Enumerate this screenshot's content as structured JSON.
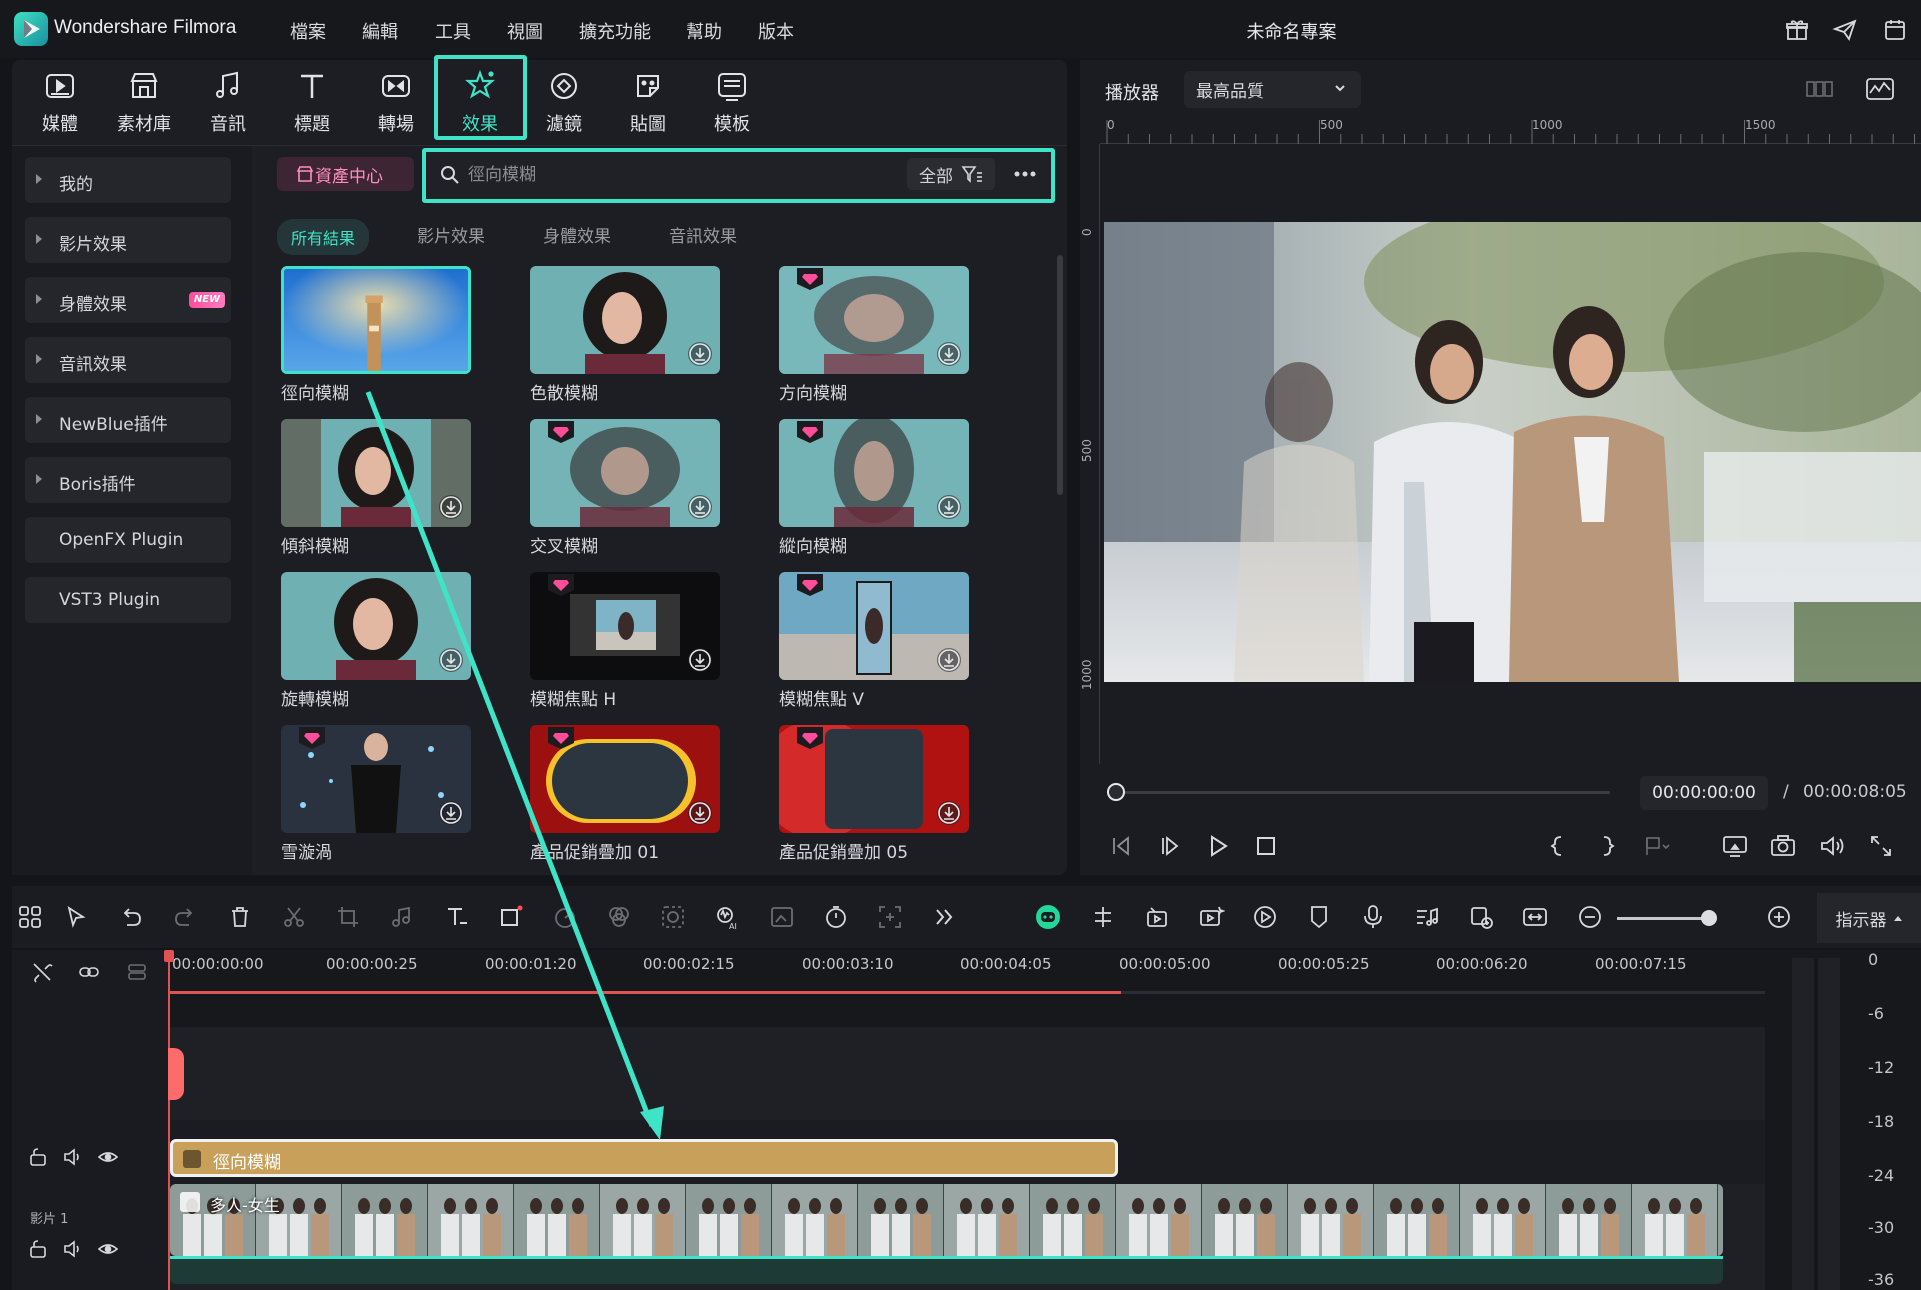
{
  "app": {
    "name": "Wondershare Filmora",
    "project_title": "未命名專案"
  },
  "menu": [
    "檔案",
    "編輯",
    "工具",
    "視圖",
    "擴充功能",
    "幫助",
    "版本"
  ],
  "library_tabs": [
    {
      "label": "媒體",
      "icon": "media-icon"
    },
    {
      "label": "素材庫",
      "icon": "stock-icon"
    },
    {
      "label": "音訊",
      "icon": "audio-icon"
    },
    {
      "label": "標題",
      "icon": "title-icon"
    },
    {
      "label": "轉場",
      "icon": "transition-icon"
    },
    {
      "label": "效果",
      "icon": "effects-icon",
      "active": true
    },
    {
      "label": "濾鏡",
      "icon": "filter-icon"
    },
    {
      "label": "貼圖",
      "icon": "sticker-icon"
    },
    {
      "label": "模板",
      "icon": "template-icon"
    }
  ],
  "sidebar": {
    "items": [
      {
        "label": "我的"
      },
      {
        "label": "影片效果"
      },
      {
        "label": "身體效果",
        "badge": "NEW"
      },
      {
        "label": "音訊效果"
      },
      {
        "label": "NewBlue插件"
      },
      {
        "label": "Boris插件"
      },
      {
        "label": "OpenFX Plugin"
      },
      {
        "label": "VST3 Plugin"
      }
    ]
  },
  "asset_center": {
    "label": "資產中心"
  },
  "search": {
    "placeholder": "徑向模糊",
    "filter_label": "全部"
  },
  "sub_tabs": [
    "所有結果",
    "影片效果",
    "身體效果",
    "音訊效果"
  ],
  "effects": [
    {
      "label": "徑向模糊",
      "selected": true
    },
    {
      "label": "色散模糊"
    },
    {
      "label": "方向模糊",
      "premium": true
    },
    {
      "label": "傾斜模糊"
    },
    {
      "label": "交叉模糊",
      "premium": true
    },
    {
      "label": "縱向模糊",
      "premium": true
    },
    {
      "label": "旋轉模糊"
    },
    {
      "label": "模糊焦點 H",
      "premium": true
    },
    {
      "label": "模糊焦點 V",
      "premium": true
    },
    {
      "label": "雪漩渦",
      "premium": true
    },
    {
      "label": "產品促銷疊加 01",
      "premium": true
    },
    {
      "label": "產品促銷疊加 05",
      "premium": true
    }
  ],
  "player": {
    "label": "播放器",
    "quality": "最高品質",
    "ruler_top": [
      "0",
      "500",
      "1000",
      "1500"
    ],
    "ruler_left": [
      "0",
      "500",
      "1000"
    ],
    "current_time": "00:00:00:00",
    "separator": "/",
    "total_time": "00:00:08:05"
  },
  "timeline": {
    "indicator_label": "指示器",
    "timecodes": [
      "00:00:00:00",
      "00:00:00:25",
      "00:00:01:20",
      "00:00:02:15",
      "00:00:03:10",
      "00:00:04:05",
      "00:00:05:00",
      "00:00:05:25",
      "00:00:06:20",
      "00:00:07:15"
    ],
    "effect_clip": "徑向模糊",
    "video_clip": "多人-女生",
    "video_track": "影片 1",
    "db_scale": [
      "0",
      "-6",
      "-12",
      "-18",
      "-24",
      "-30",
      "-36"
    ]
  },
  "colors": {
    "accent": "#3fe3c7",
    "playhead": "#e05353",
    "effect_clip": "#c8a05a"
  }
}
